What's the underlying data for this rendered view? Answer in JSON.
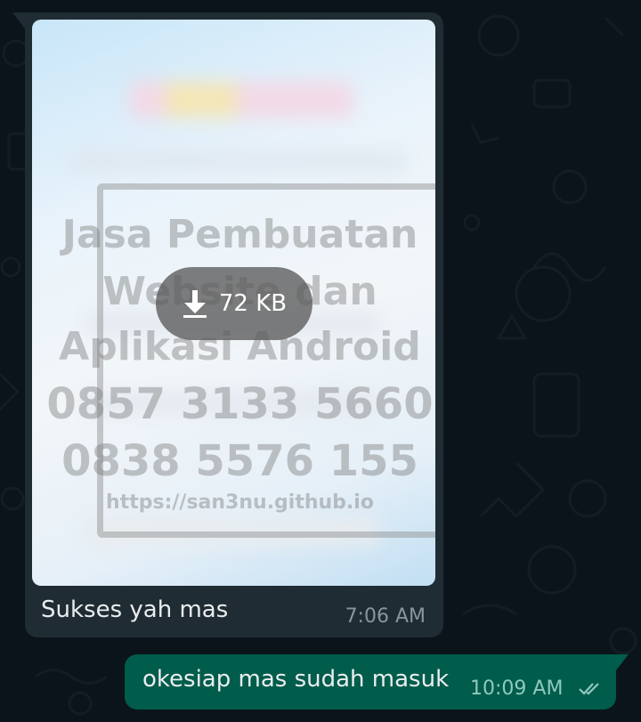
{
  "incoming_message": {
    "image": {
      "download_size": "72 KB",
      "watermark_lines": [
        "Jasa Pembuatan",
        "Website dan",
        "Aplikasi Android",
        "0857 3133 5660",
        "0838 5576 155",
        "https://san3nu.github.io"
      ]
    },
    "caption": "Sukses yah mas",
    "time": "7:06 AM"
  },
  "outgoing_message": {
    "text": "okesiap mas sudah masuk",
    "time": "10:09 AM",
    "status_icon": "double-check-icon"
  },
  "colors": {
    "chat_background": "#0b141a",
    "incoming_bubble": "#202c33",
    "outgoing_bubble": "#005c4b",
    "timestamp_in": "#8696a0",
    "timestamp_out": "#8fc9bd"
  },
  "icons": {
    "download": "download-arrow-icon",
    "read_receipt": "double-check-icon"
  }
}
